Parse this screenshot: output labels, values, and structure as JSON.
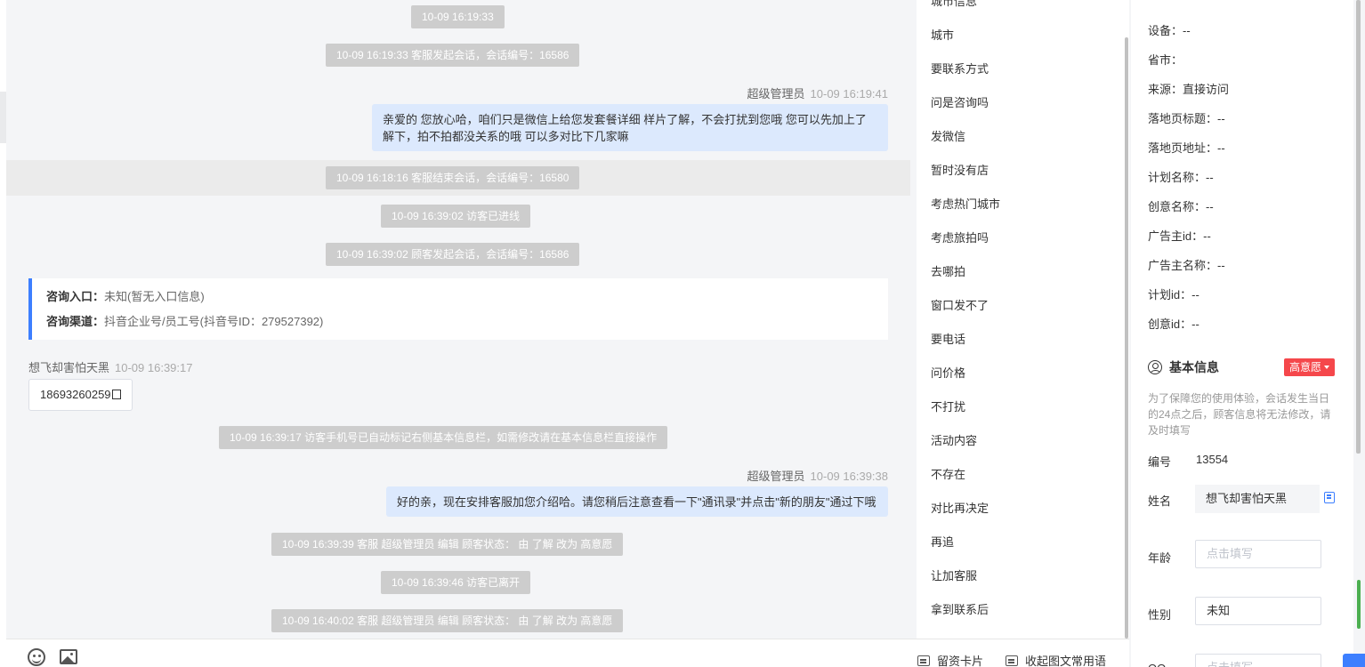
{
  "chat": {
    "sys1": "10-09 16:19:33",
    "sys2": "10-09 16:19:33 客服发起会话，会话编号：16586",
    "msg1_sender": "超级管理员",
    "msg1_time": "10-09 16:19:41",
    "msg1_line1": "亲爱的 您放心哈，咱们只是微信上给您发套餐详细 样片了解，不会打扰到您哦 您可以先加上了",
    "msg1_line2": "解下，拍不拍都没关系的哦 可以多对比下几家嘛",
    "sys3": "10-09 16:18:16 客服结束会话，会话编号：16580",
    "sys4": "10-09 16:39:02 访客已进线",
    "sys5": "10-09 16:39:02 顾客发起会话，会话编号：16586",
    "entry_label": "咨询入口：",
    "entry_value": "未知(暂无入口信息)",
    "channel_label": "咨询渠道：",
    "channel_value": "抖音企业号/员工号(抖音号ID：279527392)",
    "visitor_name": "想飞却害怕天黑",
    "visitor_time": "10-09 16:39:17",
    "phone": "18693260259",
    "sys6": "10-09 16:39:17 访客手机号已自动标记右侧基本信息栏，如需修改请在基本信息栏直接操作",
    "msg2_sender": "超级管理员",
    "msg2_time": "10-09 16:39:38",
    "msg2_text": "好的亲，现在安排客服加您介绍哈。请您稍后注意查看一下\"通讯录\"并点击\"新的朋友\"通过下哦",
    "sys7": "10-09 16:39:39 客服 超级管理员 编辑 顾客状态： 由 了解 改为 高意愿",
    "sys8": "10-09 16:39:46 访客已离开",
    "sys9": "10-09 16:40:02 客服 超级管理员 编辑 顾客状态： 由 了解 改为 高意愿"
  },
  "toolbar": {
    "card_label": "留资卡片",
    "collapse_label": "收起图文常用语"
  },
  "phrases": [
    "城市信息",
    "城市",
    "要联系方式",
    "问是咨询吗",
    "发微信",
    "暂时没有店",
    "考虑热门城市",
    "考虑旅拍吗",
    "去哪拍",
    "窗口发不了",
    "要电话",
    "问价格",
    "不打扰",
    "活动内容",
    "不存在",
    "对比再决定",
    "再追",
    "让加客服",
    "拿到联系后"
  ],
  "source_info": {
    "device": "设备：--",
    "province": "省市：",
    "source": "来源：直接访问",
    "landing_title": "落地页标题：--",
    "landing_url": "落地页地址：--",
    "plan_name": "计划名称：--",
    "creative_name": "创意名称：--",
    "advertiser_id": "广告主id：--",
    "advertiser_name": "广告主名称：--",
    "plan_id": "计划id：--",
    "creative_id": "创意id：--"
  },
  "basic_info": {
    "title": "基本信息",
    "badge": "高意愿",
    "notice": "为了保障您的使用体验，会话发生当日的24点之后，顾客信息将无法修改，请及时填写",
    "id_label": "编号",
    "id_value": "13554",
    "name_label": "姓名",
    "name_value": "想飞却害怕天黑",
    "age_label": "年龄",
    "age_placeholder": "点击填写",
    "gender_label": "性别",
    "gender_value": "未知",
    "next_label": "QQ",
    "next_placeholder": "点击填写"
  },
  "colors": {
    "accent": "#3d7fff",
    "badge": "#f5474b",
    "bubble": "#dce9fd",
    "system_pill": "#cdcdcd"
  }
}
